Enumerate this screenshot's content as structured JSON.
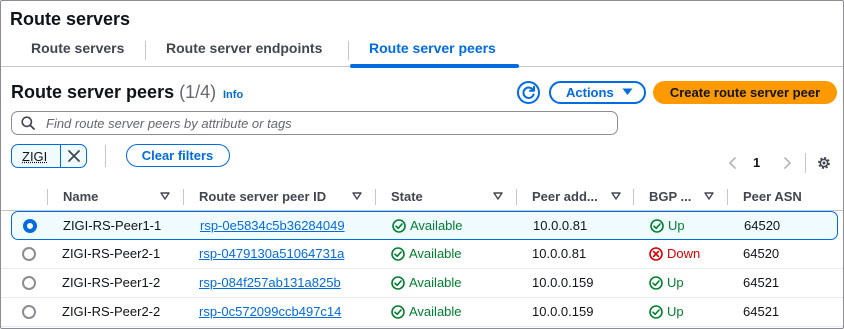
{
  "page": {
    "title": "Route servers"
  },
  "tabs": [
    {
      "label": "Route servers",
      "active": false
    },
    {
      "label": "Route server endpoints",
      "active": false
    },
    {
      "label": "Route server peers",
      "active": true
    }
  ],
  "section": {
    "title": "Route server peers",
    "count": "(1/4)",
    "info_label": "Info"
  },
  "toolbar": {
    "refresh_icon": "refresh-icon",
    "actions_label": "Actions",
    "create_label": "Create route server peer"
  },
  "search": {
    "placeholder": "Find route server peers by attribute or tags",
    "value": ""
  },
  "filter": {
    "token_label": "ZIGI",
    "clear_label": "Clear filters"
  },
  "pagination": {
    "current_page": "1"
  },
  "columns": [
    {
      "label": "Name"
    },
    {
      "label": "Route server peer ID"
    },
    {
      "label": "State"
    },
    {
      "label": "Peer add..."
    },
    {
      "label": "BGP ..."
    },
    {
      "label": "Peer ASN"
    }
  ],
  "rows": [
    {
      "selected": true,
      "name": "ZIGI-RS-Peer1-1",
      "peer_id": "rsp-0e5834c5b36284049",
      "state": "Available",
      "peer_address": "10.0.0.81",
      "bgp": "Up",
      "bgp_ok": true,
      "asn": "64520"
    },
    {
      "selected": false,
      "name": "ZIGI-RS-Peer2-1",
      "peer_id": "rsp-0479130a51064731a",
      "state": "Available",
      "peer_address": "10.0.0.81",
      "bgp": "Down",
      "bgp_ok": false,
      "asn": "64520"
    },
    {
      "selected": false,
      "name": "ZIGI-RS-Peer1-2",
      "peer_id": "rsp-084f257ab131a825b",
      "state": "Available",
      "peer_address": "10.0.0.159",
      "bgp": "Up",
      "bgp_ok": true,
      "asn": "64521"
    },
    {
      "selected": false,
      "name": "ZIGI-RS-Peer2-2",
      "peer_id": "rsp-0c572099ccb497c14",
      "state": "Available",
      "peer_address": "10.0.0.159",
      "bgp": "Up",
      "bgp_ok": true,
      "asn": "64521"
    }
  ],
  "colors": {
    "accent": "#006ce0",
    "primary_button": "#ff9900",
    "success": "#00802f",
    "error": "#db0000"
  }
}
